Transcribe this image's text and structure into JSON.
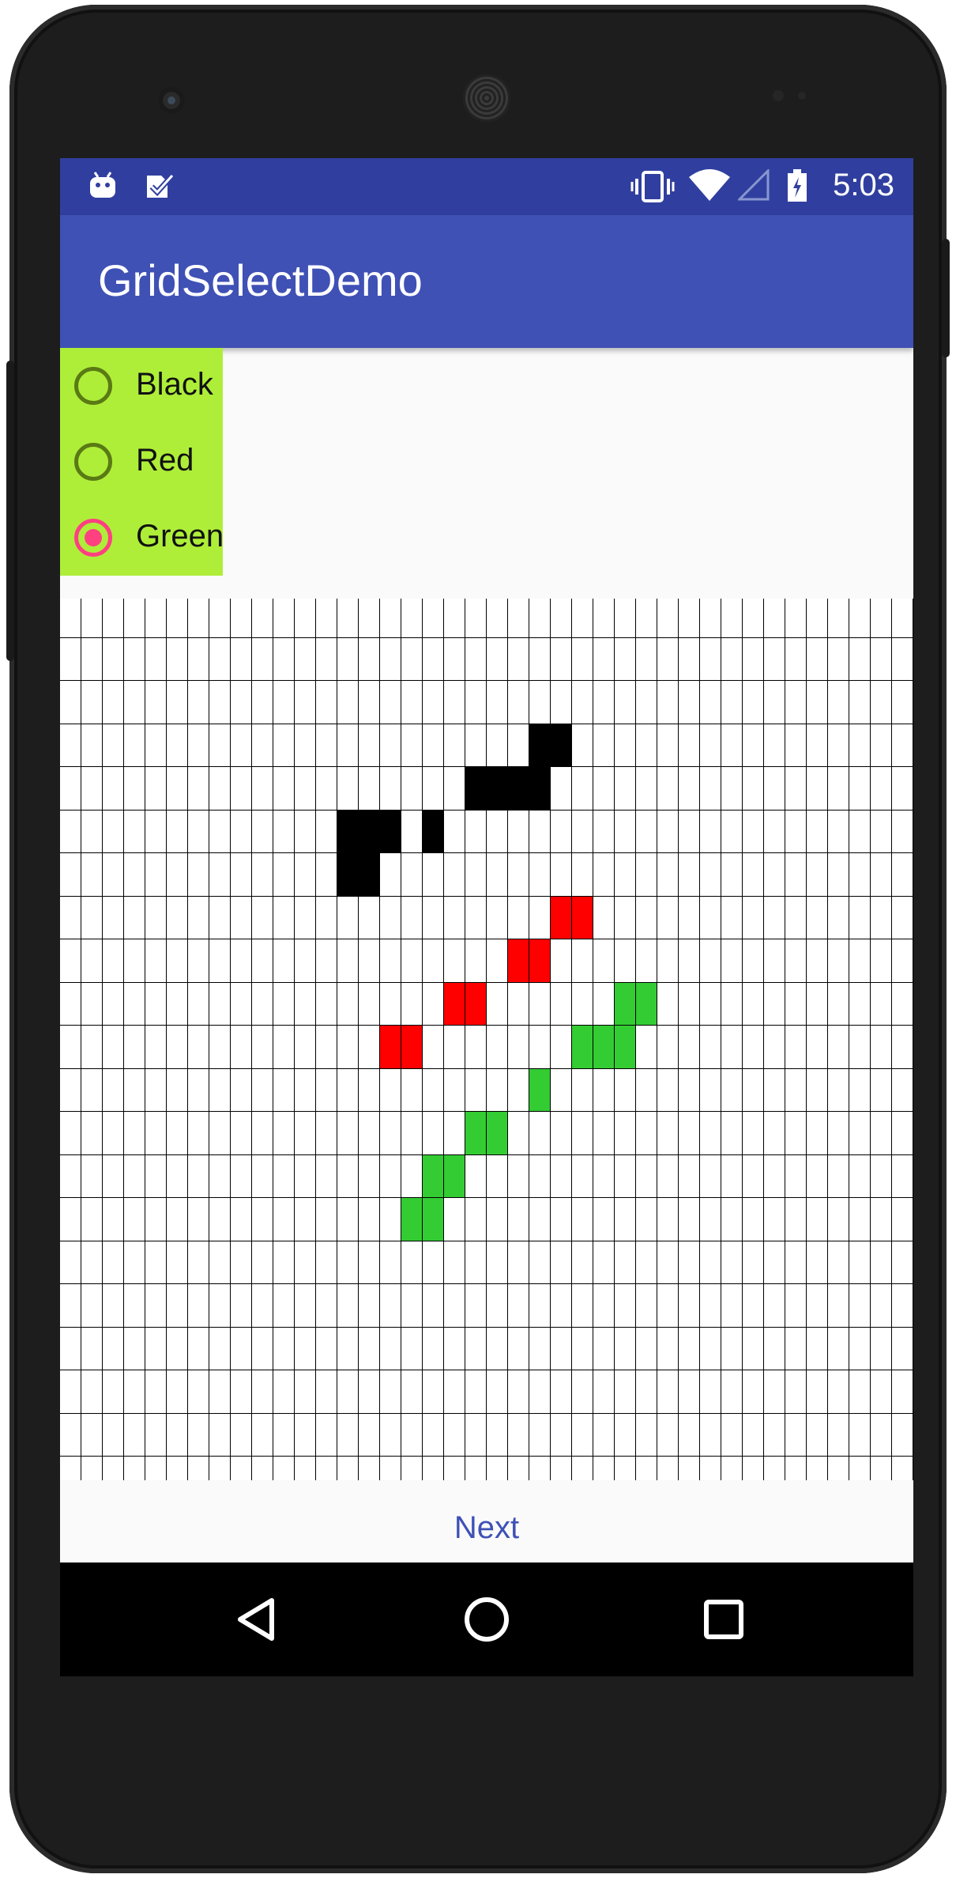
{
  "status_bar": {
    "time": "5:03",
    "icons": [
      "android-icon",
      "task-check-icon",
      "vibrate-icon",
      "wifi-icon",
      "signal-icon",
      "battery-icon"
    ]
  },
  "app_bar": {
    "title": "GridSelectDemo"
  },
  "color_picker": {
    "options": [
      {
        "label": "Black",
        "checked": false
      },
      {
        "label": "Red",
        "checked": false
      },
      {
        "label": "Green",
        "checked": true
      }
    ],
    "accent": "#ff4081",
    "background": "#aeee39"
  },
  "grid": {
    "columns": 40,
    "rows": 21,
    "filled_cells": {
      "black": [
        [
          22,
          3
        ],
        [
          23,
          3
        ],
        [
          19,
          4
        ],
        [
          20,
          4
        ],
        [
          21,
          4
        ],
        [
          22,
          4
        ],
        [
          15,
          5
        ],
        [
          17,
          5
        ],
        [
          13,
          6
        ],
        [
          14,
          6
        ],
        [
          13,
          5
        ],
        [
          14,
          5
        ]
      ],
      "red": [
        [
          23,
          7
        ],
        [
          24,
          7
        ],
        [
          21,
          8
        ],
        [
          22,
          8
        ],
        [
          18,
          9
        ],
        [
          19,
          9
        ],
        [
          15,
          10
        ],
        [
          16,
          10
        ]
      ],
      "green": [
        [
          26,
          9
        ],
        [
          27,
          9
        ],
        [
          24,
          10
        ],
        [
          25,
          10
        ],
        [
          26,
          10
        ],
        [
          22,
          11
        ],
        [
          19,
          12
        ],
        [
          20,
          12
        ],
        [
          17,
          13
        ],
        [
          18,
          13
        ],
        [
          16,
          14
        ],
        [
          17,
          14
        ]
      ]
    },
    "colors": {
      "black": "#000000",
      "red": "#ff0000",
      "green": "#33cc33"
    }
  },
  "next_button": {
    "label": "Next"
  },
  "nav_bar": {
    "buttons": [
      "back-icon",
      "home-icon",
      "recents-icon"
    ]
  }
}
